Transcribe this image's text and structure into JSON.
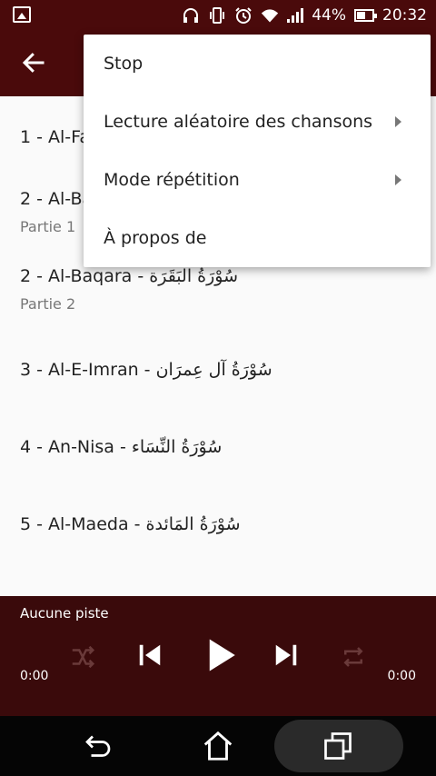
{
  "statusbar": {
    "battery": "44%",
    "time": "20:32"
  },
  "list": {
    "items": [
      {
        "title": "1 - Al-Fa",
        "sub": ""
      },
      {
        "title": "2 - Al-Ba",
        "sub": "Partie 1"
      },
      {
        "title": "2 - Al-Baqara - سُوْرَةُ البَقَرَة",
        "sub": "Partie 2"
      },
      {
        "title": "3 - Al-E-Imran - سُوْرَةُ آل عِمرَان",
        "sub": ""
      },
      {
        "title": "4 - An-Nisa - سُوْرَةُ النِّسَاء",
        "sub": ""
      },
      {
        "title": "5 - Al-Maeda - سُوْرَةُ المَائدة",
        "sub": ""
      }
    ]
  },
  "menu": {
    "stop": "Stop",
    "shuffle": "Lecture aléatoire des chansons",
    "repeat": "Mode répétition",
    "about": "À propos de"
  },
  "player": {
    "track": "Aucune piste",
    "time_elapsed": "0:00",
    "time_total": "0:00"
  },
  "colors": {
    "primary": "#4a0a0b",
    "player_bg": "#3a0a0b"
  },
  "icons": [
    "back-arrow-icon",
    "shuffle-icon",
    "previous-icon",
    "play-icon",
    "next-icon",
    "repeat-icon",
    "back-icon",
    "home-icon",
    "recents-icon"
  ]
}
